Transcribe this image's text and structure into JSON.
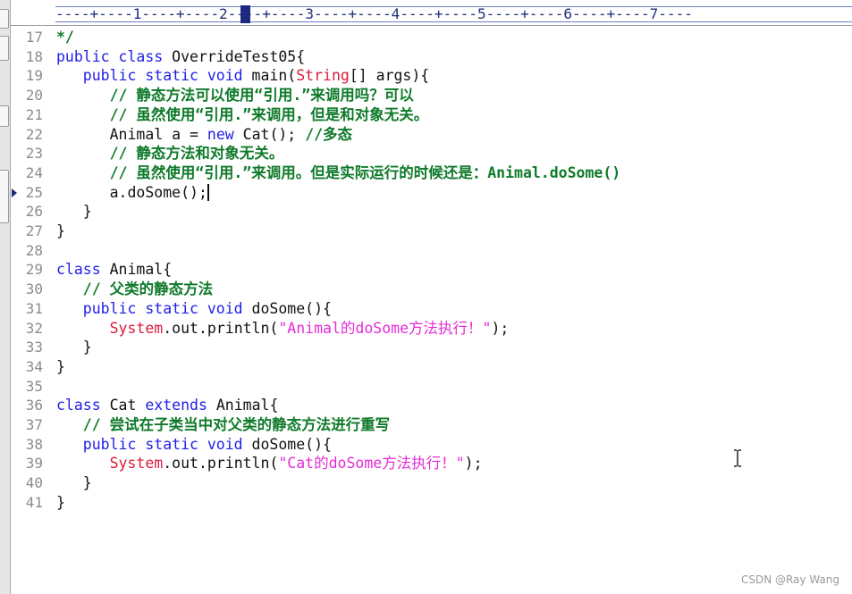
{
  "editor": {
    "ruler_text": "----+----1----+----2----+----3----+----4----+----5----+----6----+----7----",
    "current_line": "25",
    "lines": [
      {
        "num": "17",
        "segments": [
          {
            "t": "*/",
            "c": "cm"
          }
        ]
      },
      {
        "num": "18",
        "segments": [
          {
            "t": "public class ",
            "c": "kw"
          },
          {
            "t": "OverrideTest05{",
            "c": "plain"
          }
        ]
      },
      {
        "num": "19",
        "segments": [
          {
            "t": "   public static void ",
            "c": "kw"
          },
          {
            "t": "main(",
            "c": "plain"
          },
          {
            "t": "String",
            "c": "str-type"
          },
          {
            "t": "[] args){",
            "c": "plain"
          }
        ]
      },
      {
        "num": "20",
        "segments": [
          {
            "t": "      // 静态方法可以使用“引用.”来调用吗？可以",
            "c": "cm"
          }
        ]
      },
      {
        "num": "21",
        "segments": [
          {
            "t": "      // 虽然使用“引用.”来调用，但是和对象无关。",
            "c": "cm"
          }
        ]
      },
      {
        "num": "22",
        "segments": [
          {
            "t": "      Animal a = ",
            "c": "plain"
          },
          {
            "t": "new",
            "c": "kw"
          },
          {
            "t": " Cat(); ",
            "c": "plain"
          },
          {
            "t": "//多态",
            "c": "cm"
          }
        ]
      },
      {
        "num": "23",
        "segments": [
          {
            "t": "      // 静态方法和对象无关。",
            "c": "cm"
          }
        ]
      },
      {
        "num": "24",
        "segments": [
          {
            "t": "      // 虽然使用“引用.”来调用。但是实际运行的时候还是：Animal.doSome()",
            "c": "cm"
          }
        ]
      },
      {
        "num": "25",
        "segments": [
          {
            "t": "      a.doSome();",
            "c": "plain"
          }
        ],
        "caret": true
      },
      {
        "num": "26",
        "segments": [
          {
            "t": "   }",
            "c": "plain"
          }
        ]
      },
      {
        "num": "27",
        "segments": [
          {
            "t": "}",
            "c": "plain"
          }
        ]
      },
      {
        "num": "28",
        "segments": []
      },
      {
        "num": "29",
        "segments": [
          {
            "t": "class ",
            "c": "kw"
          },
          {
            "t": "Animal{",
            "c": "plain"
          }
        ]
      },
      {
        "num": "30",
        "segments": [
          {
            "t": "   // 父类的静态方法",
            "c": "cm"
          }
        ]
      },
      {
        "num": "31",
        "segments": [
          {
            "t": "   public static void ",
            "c": "kw"
          },
          {
            "t": "doSome(){",
            "c": "plain"
          }
        ]
      },
      {
        "num": "32",
        "segments": [
          {
            "t": "      ",
            "c": "plain"
          },
          {
            "t": "System",
            "c": "str-type"
          },
          {
            "t": ".out.println(",
            "c": "plain"
          },
          {
            "t": "\"Animal的doSome方法执行！\"",
            "c": "str"
          },
          {
            "t": ");",
            "c": "plain"
          }
        ]
      },
      {
        "num": "33",
        "segments": [
          {
            "t": "   }",
            "c": "plain"
          }
        ]
      },
      {
        "num": "34",
        "segments": [
          {
            "t": "}",
            "c": "plain"
          }
        ]
      },
      {
        "num": "35",
        "segments": []
      },
      {
        "num": "36",
        "segments": [
          {
            "t": "class ",
            "c": "kw"
          },
          {
            "t": "Cat ",
            "c": "plain"
          },
          {
            "t": "extends ",
            "c": "kw"
          },
          {
            "t": "Animal{",
            "c": "plain"
          }
        ]
      },
      {
        "num": "37",
        "segments": [
          {
            "t": "   // 尝试在子类当中对父类的静态方法进行重写",
            "c": "cm"
          }
        ]
      },
      {
        "num": "38",
        "segments": [
          {
            "t": "   public static void ",
            "c": "kw"
          },
          {
            "t": "doSome(){",
            "c": "plain"
          }
        ]
      },
      {
        "num": "39",
        "segments": [
          {
            "t": "      ",
            "c": "plain"
          },
          {
            "t": "System",
            "c": "str-type"
          },
          {
            "t": ".out.println(",
            "c": "plain"
          },
          {
            "t": "\"Cat的doSome方法执行！\"",
            "c": "str"
          },
          {
            "t": ");",
            "c": "plain"
          }
        ]
      },
      {
        "num": "40",
        "segments": [
          {
            "t": "   }",
            "c": "plain"
          }
        ]
      },
      {
        "num": "41",
        "segments": [
          {
            "t": "}",
            "c": "plain"
          }
        ]
      }
    ]
  },
  "colors": {
    "keyword": "#1e1ee6",
    "comment": "#0f7a2a",
    "string": "#e52bd8",
    "type": "#d81b3a"
  },
  "icons": {
    "cursor": "text-ibeam-icon",
    "line_marker": "current-line-arrow-icon"
  },
  "watermark": "CSDN @Ray Wang"
}
